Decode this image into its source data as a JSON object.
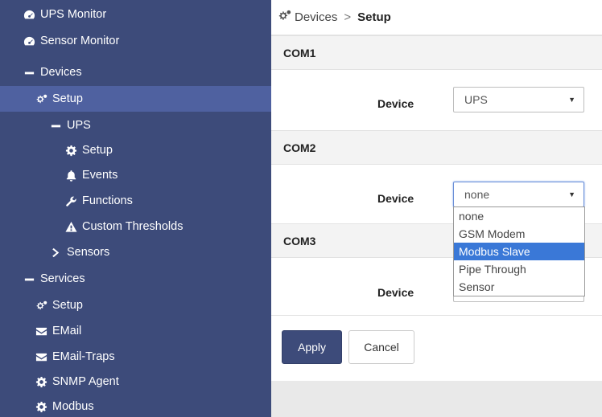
{
  "sidebar": {
    "items": [
      {
        "label": "UPS Monitor",
        "icon": "tachometer-icon"
      },
      {
        "label": "Sensor Monitor",
        "icon": "tachometer-icon"
      },
      {
        "label": "Devices",
        "icon": "minus-icon"
      },
      {
        "label": "Setup",
        "icon": "gears-icon"
      },
      {
        "label": "UPS",
        "icon": "minus-icon"
      },
      {
        "label": "Setup",
        "icon": "gear-icon"
      },
      {
        "label": "Events",
        "icon": "bell-icon"
      },
      {
        "label": "Functions",
        "icon": "wrench-icon"
      },
      {
        "label": "Custom Thresholds",
        "icon": "warning-icon"
      },
      {
        "label": "Sensors",
        "icon": "chevron-right-icon"
      },
      {
        "label": "Services",
        "icon": "minus-icon"
      },
      {
        "label": "Setup",
        "icon": "gears-icon"
      },
      {
        "label": "EMail",
        "icon": "envelope-icon"
      },
      {
        "label": "EMail-Traps",
        "icon": "envelope-icon"
      },
      {
        "label": "SNMP Agent",
        "icon": "gear-icon"
      },
      {
        "label": "Modbus",
        "icon": "gear-icon"
      }
    ],
    "active_index": 3
  },
  "breadcrumb": {
    "parent": "Devices",
    "separator": ">",
    "current": "Setup"
  },
  "sections": [
    {
      "title": "COM1",
      "field_label": "Device",
      "value": "UPS"
    },
    {
      "title": "COM2",
      "field_label": "Device",
      "value": "none"
    },
    {
      "title": "COM3",
      "field_label": "Device",
      "value": ""
    }
  ],
  "dropdown": {
    "options": [
      "none",
      "GSM Modem",
      "Modbus Slave",
      "Pipe Through",
      "Sensor"
    ],
    "highlighted": "Modbus Slave"
  },
  "buttons": {
    "apply": "Apply",
    "cancel": "Cancel"
  },
  "colors": {
    "sidebar_bg": "#3d4b7a",
    "sidebar_active": "#4f61a0",
    "highlight": "#3a78d7"
  }
}
